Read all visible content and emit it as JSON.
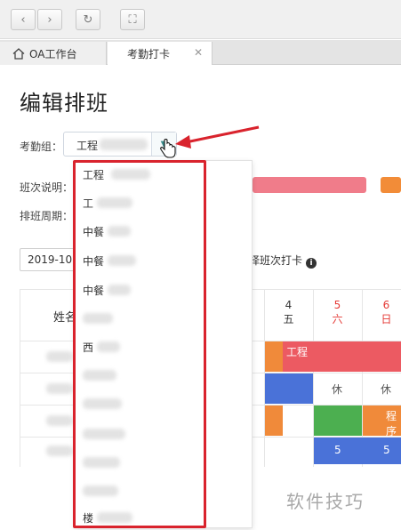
{
  "toolbar": {
    "buttons": [
      {
        "name": "back-button",
        "glyph": "‹"
      },
      {
        "name": "forward-button",
        "glyph": "›"
      },
      {
        "name": "refresh-button",
        "glyph": "↻"
      },
      {
        "name": "fullscreen-button",
        "glyph": "⛶"
      }
    ]
  },
  "tabs": {
    "home_label": "OA工作台",
    "active_label": "考勤打卡",
    "close_glyph": "✕"
  },
  "page": {
    "title": "编辑排班"
  },
  "form": {
    "group_label": "考勤组：",
    "group_value": "工程",
    "shift_label": "班次说明：",
    "period_label": "排班周期："
  },
  "dropdown": {
    "items": [
      "工程",
      "工",
      "中餐",
      "中餐",
      "中餐",
      "",
      "西",
      "",
      "",
      "",
      "",
      "",
      "楼"
    ]
  },
  "toolbar2": {
    "month_value": "2019-10",
    "hint": "选择班次打卡",
    "info_glyph": "i"
  },
  "grid": {
    "name_header": "姓名",
    "days": [
      {
        "num": "4",
        "week": "五",
        "weekend": false
      },
      {
        "num": "5",
        "week": "六",
        "weekend": true
      },
      {
        "num": "6",
        "week": "日",
        "weekend": true
      }
    ],
    "cells": [
      "工程",
      "休",
      "休",
      "程序",
      "5",
      "5"
    ]
  },
  "colors": {
    "highlight": "#d9232d",
    "strip_pink": "#f07c8a",
    "strip_orange": "#f28c38",
    "cell_red": "#ec5a62",
    "cell_blue": "#4a72d8",
    "cell_orange": "#f08a3a",
    "cell_green": "#4caf50"
  },
  "watermark": "软件技巧"
}
